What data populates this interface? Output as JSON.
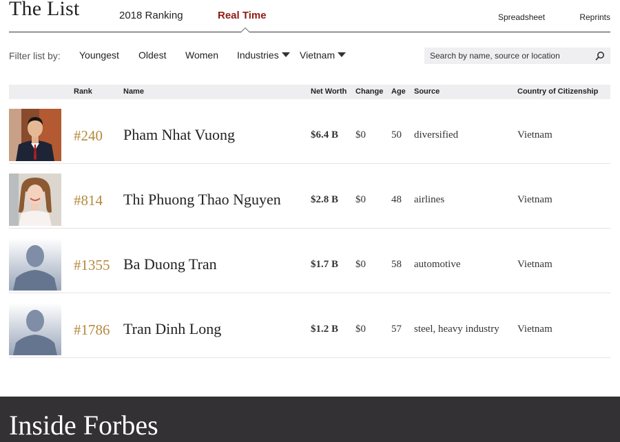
{
  "header": {
    "title": "The List",
    "tabs": [
      {
        "label": "2018 Ranking",
        "active": false
      },
      {
        "label": "Real Time",
        "active": true
      }
    ],
    "links": {
      "spreadsheet": "Spreadsheet",
      "reprints": "Reprints"
    }
  },
  "filters": {
    "label": "Filter list by:",
    "options": [
      "Youngest",
      "Oldest",
      "Women"
    ],
    "dropdowns": {
      "industries": "Industries",
      "country": "Vietnam"
    }
  },
  "search": {
    "placeholder": "Search by name, source or location"
  },
  "table": {
    "columns": {
      "rank": "Rank",
      "name": "Name",
      "net_worth": "Net Worth",
      "change": "Change",
      "age": "Age",
      "source": "Source",
      "country": "Country of Citizenship"
    },
    "rows": [
      {
        "rank": "#240",
        "name": "Pham Nhat Vuong",
        "net_worth": "$6.4 B",
        "change": "$0",
        "age": "50",
        "source": "diversified",
        "country": "Vietnam",
        "photo": "photo-man"
      },
      {
        "rank": "#814",
        "name": "Thi Phuong Thao Nguyen",
        "net_worth": "$2.8 B",
        "change": "$0",
        "age": "48",
        "source": "airlines",
        "country": "Vietnam",
        "photo": "photo-woman"
      },
      {
        "rank": "#1355",
        "name": "Ba Duong Tran",
        "net_worth": "$1.7 B",
        "change": "$0",
        "age": "58",
        "source": "automotive",
        "country": "Vietnam",
        "photo": "placeholder"
      },
      {
        "rank": "#1786",
        "name": "Tran Dinh Long",
        "net_worth": "$1.2 B",
        "change": "$0",
        "age": "57",
        "source": "steel, heavy industry",
        "country": "Vietnam",
        "photo": "placeholder"
      }
    ]
  },
  "footer": {
    "title": "Inside Forbes"
  },
  "colors": {
    "accent_red": "#8e1a12",
    "rank_gold": "#b48a3c",
    "footer_bg": "#333133",
    "header_bg": "#eeedf0"
  }
}
